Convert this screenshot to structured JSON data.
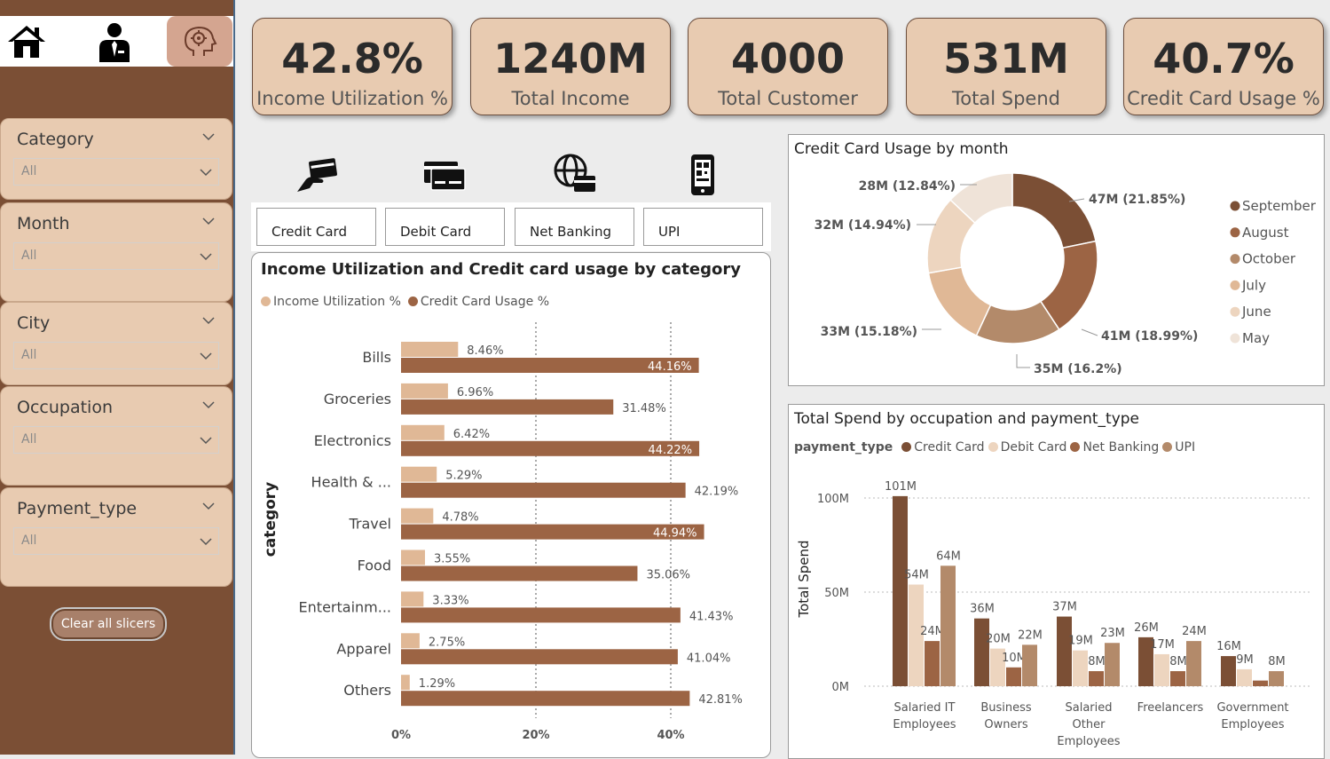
{
  "nav": {
    "home_icon": "home-icon",
    "person_icon": "person-icon",
    "settings_icon": "gear-brain-icon"
  },
  "slicers": [
    {
      "title": "Category",
      "value": "All"
    },
    {
      "title": "Month",
      "value": "All"
    },
    {
      "title": "City",
      "value": "All"
    },
    {
      "title": "Occupation",
      "value": "All"
    },
    {
      "title": "Payment_type",
      "value": "All"
    }
  ],
  "clear_label": "Clear all slicers",
  "kpis": [
    {
      "value": "42.8%",
      "label": "Income Utilization %"
    },
    {
      "value": "1240M",
      "label": "Total Income"
    },
    {
      "value": "4000",
      "label": "Total Customer"
    },
    {
      "value": "531M",
      "label": "Total Spend"
    },
    {
      "value": "40.7%",
      "label": "Credit Card Usage %"
    }
  ],
  "payment_buttons": [
    "Credit Card",
    "Debit Card",
    "Net Banking",
    "UPI"
  ],
  "colors": {
    "dark": "#7b4f35",
    "mid": "#9c6444",
    "tan": "#b38a6a",
    "light": "#e0b896",
    "pale": "#edd5bf",
    "palest": "#efe3d8",
    "sidebar": "#7b4f35",
    "card": "#e8cbb1"
  },
  "chart_data": [
    {
      "type": "bar",
      "orientation": "horizontal",
      "title": "Income Utilization and Credit card usage by category",
      "ylabel": "category",
      "categories": [
        "Bills",
        "Groceries",
        "Electronics",
        "Health & ...",
        "Travel",
        "Food",
        "Entertainm...",
        "Apparel",
        "Others"
      ],
      "series": [
        {
          "name": "Income Utilization %",
          "values": [
            8.46,
            6.96,
            6.42,
            5.29,
            4.78,
            3.55,
            3.33,
            2.75,
            1.29
          ],
          "labels": [
            "8.46%",
            "6.96%",
            "6.42%",
            "5.29%",
            "4.78%",
            "3.55%",
            "3.33%",
            "2.75%",
            "1.29%"
          ]
        },
        {
          "name": "Credit Card Usage %",
          "values": [
            44.16,
            31.48,
            44.22,
            42.19,
            44.94,
            35.06,
            41.43,
            41.04,
            42.81
          ],
          "labels": [
            "44.16%",
            "31.48%",
            "44.22%",
            "42.19%",
            "44.94%",
            "35.06%",
            "41.43%",
            "41.04%",
            "42.81%"
          ]
        }
      ],
      "xticks": [
        "0%",
        "20%",
        "40%"
      ],
      "xlim": [
        0,
        50
      ],
      "grid": true,
      "legend": "top-left"
    },
    {
      "type": "pie",
      "title": "Credit Card Usage by month",
      "slices": [
        {
          "name": "September",
          "value": 47,
          "label": "47M (21.85%)"
        },
        {
          "name": "August",
          "value": 41,
          "label": "41M (18.99%)"
        },
        {
          "name": "October",
          "value": 35,
          "label": "35M (16.2%)"
        },
        {
          "name": "July",
          "value": 33,
          "label": "33M (15.18%)"
        },
        {
          "name": "June",
          "value": 32,
          "label": "32M (14.94%)"
        },
        {
          "name": "May",
          "value": 28,
          "label": "28M (12.84%)"
        }
      ],
      "legend": "right"
    },
    {
      "type": "bar",
      "title": "Total Spend by occupation and payment_type",
      "legend_title": "payment_type",
      "ylabel": "Total Spend",
      "categories": [
        "Salaried IT Employees",
        "Business Owners",
        "Salaried Other Employees",
        "Freelancers",
        "Government Employees"
      ],
      "category_lines": [
        [
          "Salaried IT",
          "Employees"
        ],
        [
          "Business",
          "Owners"
        ],
        [
          "Salaried",
          "Other",
          "Employees"
        ],
        [
          "Freelancers"
        ],
        [
          "Government",
          "Employees"
        ]
      ],
      "series": [
        {
          "name": "Credit Card",
          "values": [
            101,
            36,
            37,
            26,
            16
          ],
          "labels": [
            "101M",
            "36M",
            "37M",
            "26M",
            "16M"
          ]
        },
        {
          "name": "Debit Card",
          "values": [
            54,
            20,
            19,
            17,
            9
          ],
          "labels": [
            "54M",
            "20M",
            "19M",
            "17M",
            "9M"
          ]
        },
        {
          "name": "Net Banking",
          "values": [
            24,
            10,
            8,
            8,
            3
          ],
          "labels": [
            "24M",
            "10M",
            "8M",
            "8M",
            ""
          ]
        },
        {
          "name": "UPI",
          "values": [
            64,
            22,
            23,
            24,
            8
          ],
          "labels": [
            "64M",
            "22M",
            "23M",
            "24M",
            "8M"
          ]
        }
      ],
      "yticks": [
        "0M",
        "50M",
        "100M"
      ],
      "ylim": [
        0,
        110
      ],
      "legend": "top-left"
    }
  ]
}
